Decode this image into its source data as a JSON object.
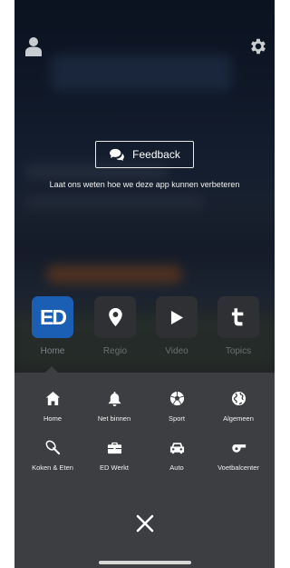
{
  "feedback": {
    "button_label": "Feedback",
    "message": "Laat ons weten hoe we deze app kunnen verbeteren"
  },
  "categories": [
    {
      "label": "Home",
      "icon": "ed-logo-icon",
      "active": true
    },
    {
      "label": "Regio",
      "icon": "map-pin-icon",
      "active": false
    },
    {
      "label": "Video",
      "icon": "play-icon",
      "active": false
    },
    {
      "label": "Topics",
      "icon": "topics-t-icon",
      "active": false
    }
  ],
  "logo_text": "ED",
  "menu": [
    {
      "label": "Home",
      "icon": "house-icon"
    },
    {
      "label": "Net binnen",
      "icon": "bell-icon"
    },
    {
      "label": "Sport",
      "icon": "soccer-ball-icon"
    },
    {
      "label": "Algemeen",
      "icon": "globe-icon"
    },
    {
      "label": "Koken & Eten",
      "icon": "whisk-icon"
    },
    {
      "label": "ED Werkt",
      "icon": "briefcase-icon"
    },
    {
      "label": "Auto",
      "icon": "car-icon"
    },
    {
      "label": "Voetbalcenter",
      "icon": "whistle-icon"
    }
  ],
  "colors": {
    "accent": "#1b5fb5",
    "panel": "#3c3e41",
    "tile": "#2e3033"
  }
}
